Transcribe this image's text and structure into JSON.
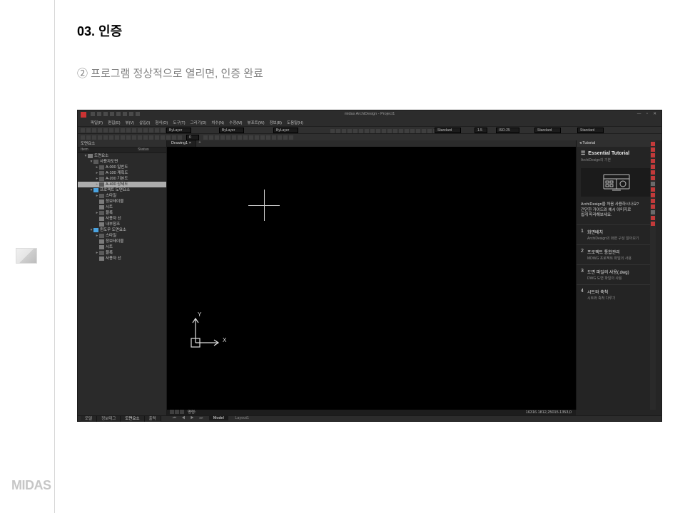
{
  "page": {
    "title": "03. 인증",
    "subtitle": "② 프로그램 정상적으로 열리면, 인증 완료",
    "footer_brand": "MIDAS"
  },
  "app": {
    "window_title": "midas ArchiDesign - Project1",
    "window_buttons": "—  ▫  ✕",
    "menus": [
      "파일(F)",
      "편집(E)",
      "뷰(V)",
      "삽입(I)",
      "형식(O)",
      "도구(T)",
      "그리기(D)",
      "치수(N)",
      "수정(M)",
      "뷰포트(W)",
      "정보(B)",
      "도움말(H)"
    ],
    "bylayer": "ByLayer",
    "standard": "Standard",
    "iso25": "ISO-25",
    "one_five": "1.5"
  },
  "panel": {
    "title": "도면요소",
    "col1": "Item",
    "col2": "Status",
    "tree": {
      "root": "도면요소",
      "g1": "사용자도면",
      "g1a": "A-000 일반도",
      "g1b": "A-100 계획도",
      "g1c": "A-200 기본도",
      "g1d": "A-400 상세도",
      "g2": "프로젝트 도면요소",
      "g2a": "스타일",
      "g2b": "정보테이블",
      "g2c": "시트",
      "g2d": "블록",
      "g2e": "사용자 선",
      "g2f": "내부참조",
      "g3": "윈도우 도면요소",
      "g3a": "스타일",
      "g3b": "정보테이블",
      "g3c": "시트",
      "g3d": "블록",
      "g3e": "사용자 선"
    }
  },
  "dtab": "Drawing1",
  "ucs": {
    "x": "X",
    "y": "Y"
  },
  "tutorial": {
    "tab": "Tutorial",
    "title": "Essential Tutorial",
    "subtitle": "ArchiDesign의 기본",
    "desc": "ArchiDesign을 처음 사용하시나요?\n간단한 가이드와 예시 이미지로\n쉽게 따라해보세요.",
    "items": [
      {
        "n": "1",
        "t1": "화면배치",
        "t2": "ArchiDesign의 화면 구성 알아보기"
      },
      {
        "n": "2",
        "t1": "프로젝트 통합관리",
        "t2": "MDWG 프로젝트 파일의 사용"
      },
      {
        "n": "3",
        "t1": "도면 파일의 사용(.dwg)",
        "t2": "DWG 도면 파일의 사용"
      },
      {
        "n": "4",
        "t1": "시트와 축척",
        "t2": "시트와 축척 다루기"
      }
    ]
  },
  "status": {
    "tabs": [
      "모델",
      "정보태그",
      "도면요소",
      "출력"
    ],
    "mtabs": [
      "Model",
      "Layout1"
    ],
    "cmd_label": "명령:",
    "coords": "16316.1812,25015.1353,0"
  }
}
